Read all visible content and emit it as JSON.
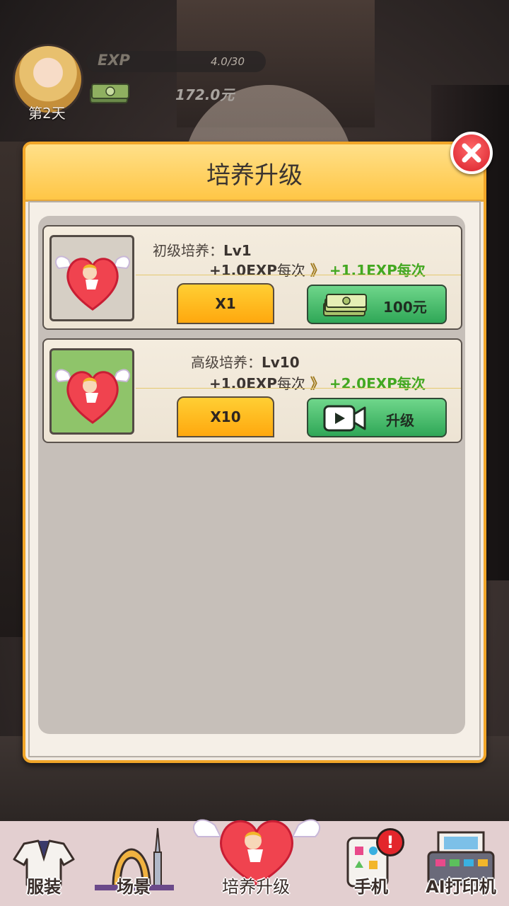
{
  "hud": {
    "day": "第2天",
    "exp_label": "EXP",
    "exp_value": "4.0/30",
    "exp_progress": 0.133,
    "money": "172.0元"
  },
  "dialog": {
    "title": "培养升级",
    "close_icon": "close-icon"
  },
  "cards": [
    {
      "name": "初级培养：",
      "level": "Lv1",
      "current_rate": "+1.0EXP",
      "current_unit": "每次",
      "arrow": "》",
      "next_rate": "+1.1EXP每次",
      "multiplier": "X1",
      "action_label": "100元",
      "action_icon": "cash-stack-icon"
    },
    {
      "name": "高级培养：",
      "level": "Lv10",
      "current_rate": "+1.0EXP",
      "current_unit": "每次",
      "arrow": "》",
      "next_rate": "+2.0EXP每次",
      "multiplier": "X10",
      "action_label": "升级",
      "action_icon": "video-ad-icon"
    }
  ],
  "nav": [
    {
      "label": "服装",
      "icon": "outfit-icon"
    },
    {
      "label": "场景",
      "icon": "scene-icon"
    },
    {
      "label": "培养升级",
      "icon": "cupid-heart-icon"
    },
    {
      "label": "手机",
      "icon": "phone-icon"
    },
    {
      "label": "AI打印机",
      "icon": "printer-icon"
    }
  ],
  "nav_badge": "!",
  "colors": {
    "accent_orange": "#f1a629",
    "green_button": "#2fa757",
    "yellow_button": "#ffa80e",
    "next_rate_green": "#43a821",
    "close_red": "#d81f2a"
  }
}
